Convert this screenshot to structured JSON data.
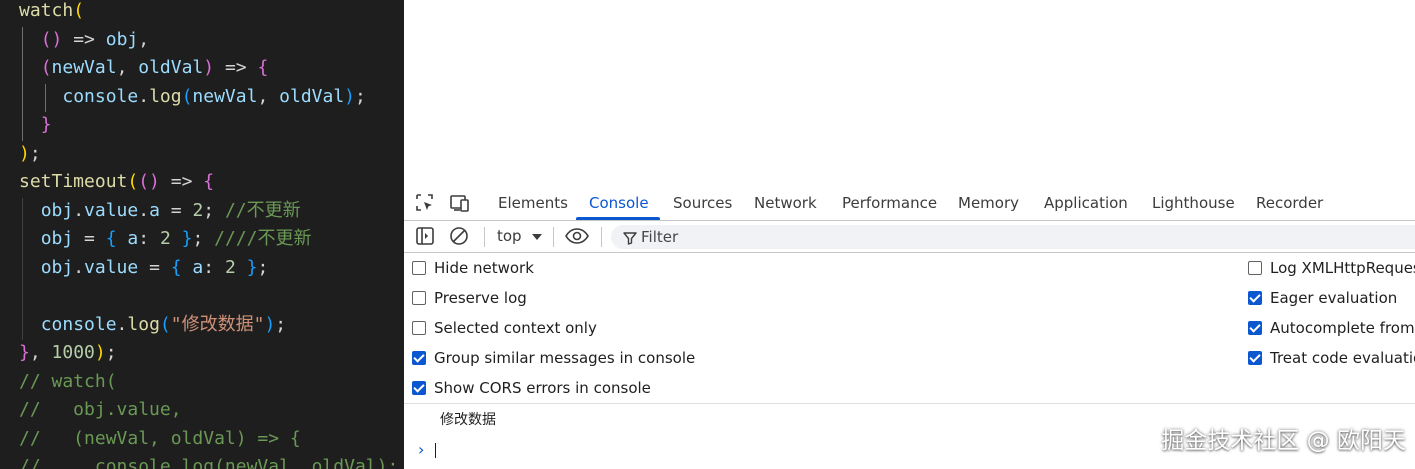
{
  "editor": {
    "lines": [
      [
        [
          "watch",
          "fn"
        ],
        [
          "(",
          "b1"
        ]
      ],
      [
        [
          "  ",
          "op"
        ],
        [
          "()",
          "b2"
        ],
        [
          " => ",
          "op"
        ],
        [
          "obj",
          "var"
        ],
        [
          ",",
          "op"
        ]
      ],
      [
        [
          "  ",
          "op"
        ],
        [
          "(",
          "b2"
        ],
        [
          "newVal",
          "var"
        ],
        [
          ", ",
          "op"
        ],
        [
          "oldVal",
          "var"
        ],
        [
          ")",
          "b2"
        ],
        [
          " => ",
          "op"
        ],
        [
          "{",
          "b2"
        ]
      ],
      [
        [
          "    ",
          "op"
        ],
        [
          "console",
          "var"
        ],
        [
          ".",
          "op"
        ],
        [
          "log",
          "fn"
        ],
        [
          "(",
          "b3"
        ],
        [
          "newVal",
          "var"
        ],
        [
          ", ",
          "op"
        ],
        [
          "oldVal",
          "var"
        ],
        [
          ")",
          "b3"
        ],
        [
          ";",
          "op"
        ]
      ],
      [
        [
          "  ",
          "op"
        ],
        [
          "}",
          "b2"
        ]
      ],
      [
        [
          ")",
          "b1"
        ],
        [
          ";",
          "op"
        ]
      ],
      [
        [
          "setTimeout",
          "fn"
        ],
        [
          "(",
          "b1"
        ],
        [
          "()",
          "b2"
        ],
        [
          " => ",
          "op"
        ],
        [
          "{",
          "b2"
        ]
      ],
      [
        [
          "  ",
          "op"
        ],
        [
          "obj",
          "var"
        ],
        [
          ".",
          "op"
        ],
        [
          "value",
          "var"
        ],
        [
          ".",
          "op"
        ],
        [
          "a",
          "var"
        ],
        [
          " = ",
          "op"
        ],
        [
          "2",
          "num"
        ],
        [
          ";",
          "op"
        ],
        [
          " //不更新",
          "cm"
        ]
      ],
      [
        [
          "  ",
          "op"
        ],
        [
          "obj",
          "var"
        ],
        [
          " = ",
          "op"
        ],
        [
          "{",
          "b3"
        ],
        [
          " a",
          "var"
        ],
        [
          ": ",
          "op"
        ],
        [
          "2",
          "num"
        ],
        [
          " }",
          "b3"
        ],
        [
          ";",
          "op"
        ],
        [
          " ////不更新",
          "cm"
        ]
      ],
      [
        [
          "  ",
          "op"
        ],
        [
          "obj",
          "var"
        ],
        [
          ".",
          "op"
        ],
        [
          "value",
          "var"
        ],
        [
          " = ",
          "op"
        ],
        [
          "{",
          "b3"
        ],
        [
          " a",
          "var"
        ],
        [
          ": ",
          "op"
        ],
        [
          "2",
          "num"
        ],
        [
          " }",
          "b3"
        ],
        [
          ";",
          "op"
        ]
      ],
      [],
      [
        [
          "  ",
          "op"
        ],
        [
          "console",
          "var"
        ],
        [
          ".",
          "op"
        ],
        [
          "log",
          "fn"
        ],
        [
          "(",
          "b3"
        ],
        [
          "\"修改数据\"",
          "str"
        ],
        [
          ")",
          "b3"
        ],
        [
          ";",
          "op"
        ]
      ],
      [
        [
          "}",
          "b2"
        ],
        [
          ", ",
          "op"
        ],
        [
          "1000",
          "num"
        ],
        [
          ")",
          "b1"
        ],
        [
          ";",
          "op"
        ]
      ],
      [
        [
          "// watch(",
          "cm"
        ]
      ],
      [
        [
          "//   obj.value,",
          "cm"
        ]
      ],
      [
        [
          "//   (newVal, oldVal) => {",
          "cm"
        ]
      ],
      [
        [
          "//     console.log(newVal, oldVal);",
          "cm"
        ]
      ]
    ]
  },
  "devtools": {
    "icons": {
      "inspect": "inspect-element-icon",
      "device": "device-toolbar-icon",
      "sidebar": "show-sidebar-icon",
      "clear": "clear-console-icon",
      "eye": "live-expression-icon",
      "filter": "filter-icon",
      "dropdown": "chevron-down-icon",
      "prompt": "prompt-chevron-icon"
    },
    "tabs": [
      {
        "label": "Elements"
      },
      {
        "label": "Console"
      },
      {
        "label": "Sources"
      },
      {
        "label": "Network"
      },
      {
        "label": "Performance"
      },
      {
        "label": "Memory"
      },
      {
        "label": "Application"
      },
      {
        "label": "Lighthouse"
      },
      {
        "label": "Recorder"
      }
    ],
    "active_tab": "Console",
    "console_bar": {
      "context": "top",
      "filter_placeholder": "Filter"
    },
    "settings_left": [
      {
        "label": "Hide network",
        "checked": false
      },
      {
        "label": "Preserve log",
        "checked": false
      },
      {
        "label": "Selected context only",
        "checked": false
      },
      {
        "label": "Group similar messages in console",
        "checked": true
      },
      {
        "label": "Show CORS errors in console",
        "checked": true
      }
    ],
    "settings_right": [
      {
        "label": "Log XMLHttpRequests",
        "checked": false
      },
      {
        "label": "Eager evaluation",
        "checked": true
      },
      {
        "label": "Autocomplete from history",
        "checked": true
      },
      {
        "label": "Treat code evaluation as user action",
        "checked": true
      }
    ],
    "log_message": "修改数据",
    "prompt_symbol": "›"
  },
  "watermark": "掘金技术社区 @ 欧阳天",
  "colors": {
    "accent": "#0b57d0",
    "editor_bg": "#1e1e1e"
  }
}
